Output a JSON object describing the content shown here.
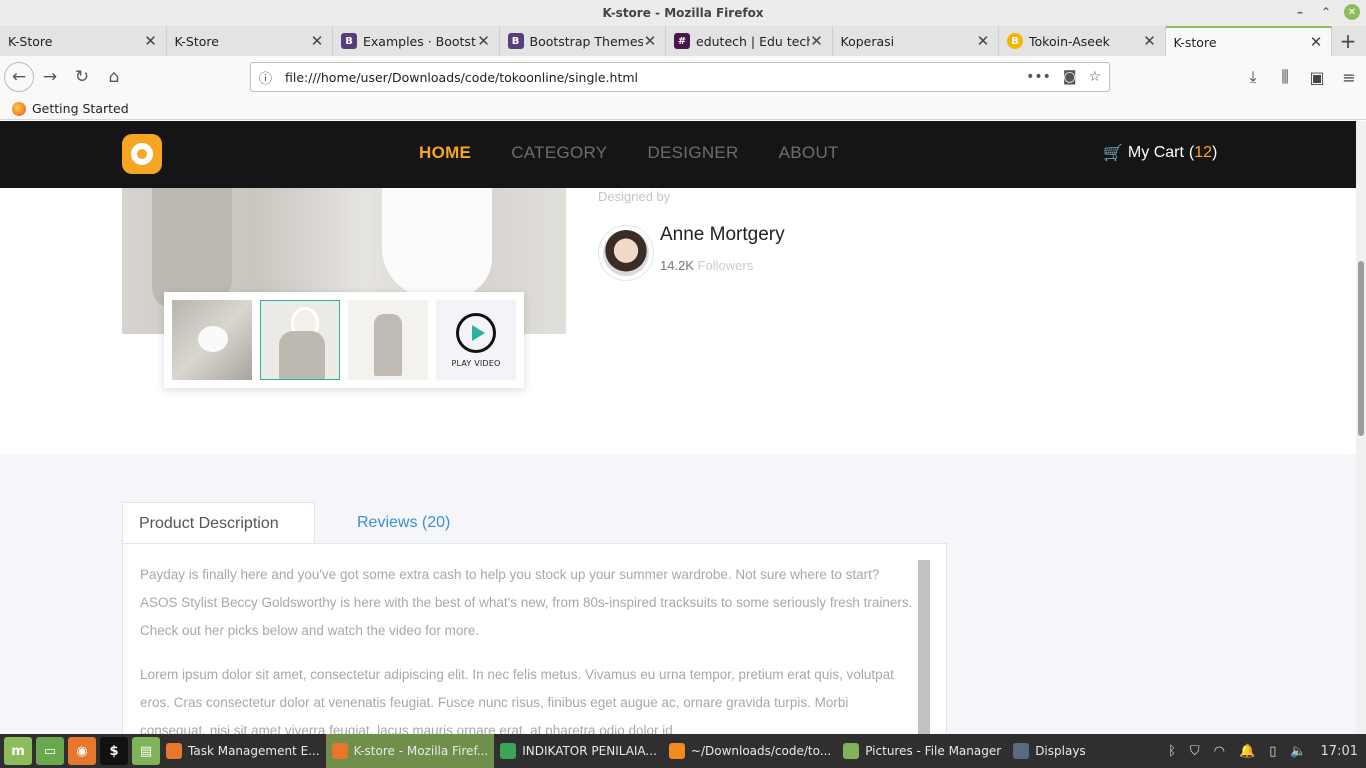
{
  "window": {
    "title": "K-store - Mozilla Firefox"
  },
  "tabs": [
    {
      "label": "K-Store",
      "favicon": "none",
      "active": false
    },
    {
      "label": "K-Store",
      "favicon": "none",
      "active": false
    },
    {
      "label": "Examples · Bootstrap",
      "favicon": "B",
      "active": false
    },
    {
      "label": "Bootstrap Themes",
      "favicon": "B",
      "active": false
    },
    {
      "label": "edutech | Edu tech",
      "favicon": "slack",
      "active": false
    },
    {
      "label": "Koperasi",
      "favicon": "none",
      "active": false
    },
    {
      "label": "Tokoin-Aseek",
      "favicon": "coin",
      "active": false
    },
    {
      "label": "K-store",
      "favicon": "none",
      "active": true
    }
  ],
  "address": {
    "url": "file:///home/user/Downloads/code/tokoonline/single.html"
  },
  "bookmarks": {
    "getting_started": "Getting Started"
  },
  "site": {
    "nav": [
      "HOME",
      "CATEGORY",
      "DESIGNER",
      "ABOUT"
    ],
    "cart_label": "My Cart",
    "cart_count": "12",
    "accent": "#f6a623"
  },
  "product": {
    "designed_by": "Designed by",
    "designer_name": "Anne Mortgery",
    "followers_count": "14.2K",
    "followers_label": "Followers",
    "play_video": "PLAY VIDEO"
  },
  "details": {
    "tab_description": "Product Description",
    "tab_reviews": "Reviews (20)",
    "paragraph1": "Payday is finally here and you've got some extra cash to help you stock up your summer wardrobe. Not sure where to start? ASOS Stylist Beccy Goldsworthy is here with the best of what's new, from 80s-inspired tracksuits to some seriously fresh trainers. Check out her picks below and watch the video for more.",
    "paragraph2": "Lorem ipsum dolor sit amet, consectetur adipiscing elit. In nec felis metus. Vivamus eu urna tempor, pretium erat quis, volutpat eros. Cras consectetur dolor at venenatis feugiat. Fusce nunc risus, finibus eget augue ac, ornare gravida turpis. Morbi consequat, nisi sit amet viverra feugiat, lacus mauris ornare erat, at pharetra odio dolor id"
  },
  "taskbar": {
    "items": [
      {
        "label": "Task Management E...",
        "active": false
      },
      {
        "label": "K-store - Mozilla Firef...",
        "active": true
      },
      {
        "label": "INDIKATOR PENILAIA...",
        "active": false
      },
      {
        "label": "~/Downloads/code/to...",
        "active": false
      },
      {
        "label": "Pictures - File Manager",
        "active": false
      },
      {
        "label": "Displays",
        "active": false
      }
    ],
    "clock": "17:01"
  }
}
